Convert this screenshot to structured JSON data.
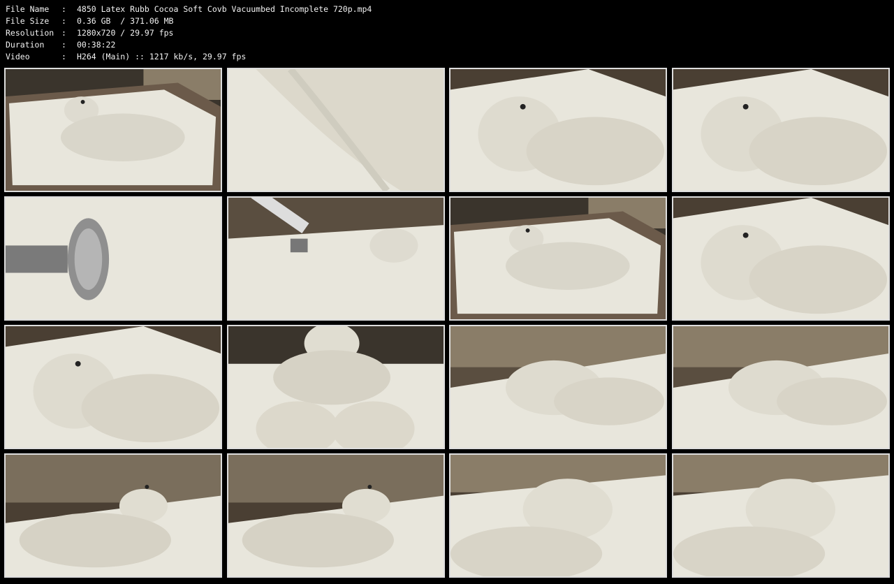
{
  "info": {
    "rows": [
      {
        "label": "File Name",
        "sep": ":",
        "value": "4850 Latex Rubb Cocoa Soft Covb Vacuumbed Incomplete 720p.mp4"
      },
      {
        "label": "File Size",
        "sep": ":",
        "value": "0.36 GB  / 371.06 MB"
      },
      {
        "label": "Resolution",
        "sep": ":",
        "value": "1280x720 / 29.97 fps"
      },
      {
        "label": "Duration",
        "sep": ":",
        "value": "00:38:22"
      },
      {
        "label": "Video",
        "sep": ":",
        "value": "H264 (Main) :: 1217 kb/s, 29.97 fps"
      }
    ]
  },
  "thumbnails": {
    "rows": 4,
    "columns": 4,
    "scenes": [
      "wide-table",
      "closeup-sheet",
      "head-closeup",
      "head-closeup",
      "massager-closeup",
      "massager-wide",
      "wide-table",
      "head-closeup",
      "head-closeup",
      "body-closeup",
      "side-view",
      "side-view",
      "low-angle",
      "low-angle",
      "head-profile",
      "head-profile"
    ]
  },
  "colors": {
    "background": "#000000",
    "text": "#f2f2f2",
    "border": "#dddddd",
    "latex": "#e8e6dc",
    "table": "#6b5a4a"
  }
}
